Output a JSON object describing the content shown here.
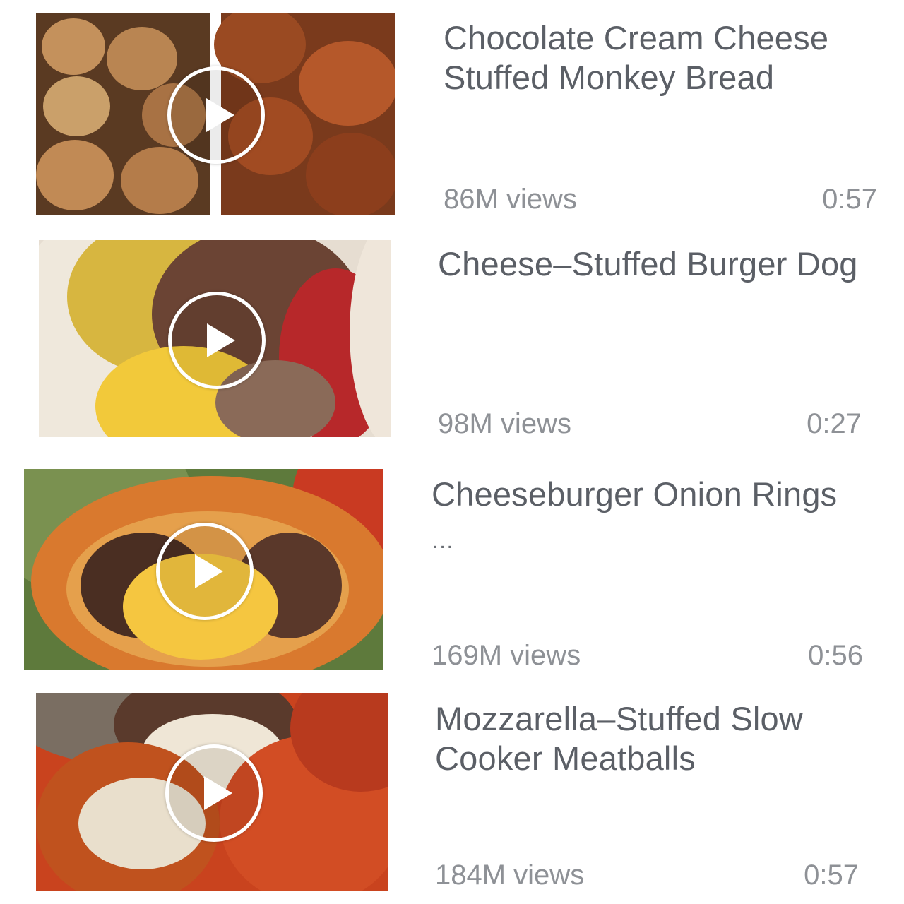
{
  "videos": [
    {
      "title_line1": "Chocolate Cream Cheese",
      "title_line2": "Stuffed Monkey Bread",
      "truncated": "",
      "views": "86M views",
      "duration": "0:57",
      "thumb_icon": "play-icon"
    },
    {
      "title_line1": "Cheese–Stuffed Burger Dog",
      "title_line2": "",
      "truncated": "",
      "views": "98M views",
      "duration": "0:27",
      "thumb_icon": "play-icon"
    },
    {
      "title_line1": "Cheeseburger Onion Rings",
      "title_line2": "",
      "truncated": "...",
      "views": "169M views",
      "duration": "0:56",
      "thumb_icon": "play-icon"
    },
    {
      "title_line1": "Mozzarella–Stuffed Slow",
      "title_line2": "Cooker Meatballs",
      "truncated": "",
      "views": "184M views",
      "duration": "0:57",
      "thumb_icon": "play-icon"
    }
  ],
  "colors": {
    "title_text": "#5b5f66",
    "meta_text": "#8e9196",
    "background": "#ffffff"
  }
}
